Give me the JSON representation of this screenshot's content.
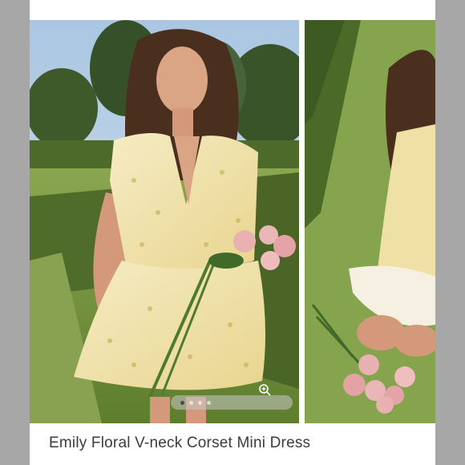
{
  "listing": {
    "title": "Emily Floral V-neck Corset Mini Dress"
  },
  "gallery": {
    "slide_count": 4,
    "active_index": 0,
    "zoom_icon": "zoom-in-icon"
  },
  "colors": {
    "frame": "#a7a7a7",
    "dress": "#efe0a6",
    "grass": "#7e9c4a",
    "hedge": "#4d6a2a",
    "roses": "#e7a9a9"
  }
}
